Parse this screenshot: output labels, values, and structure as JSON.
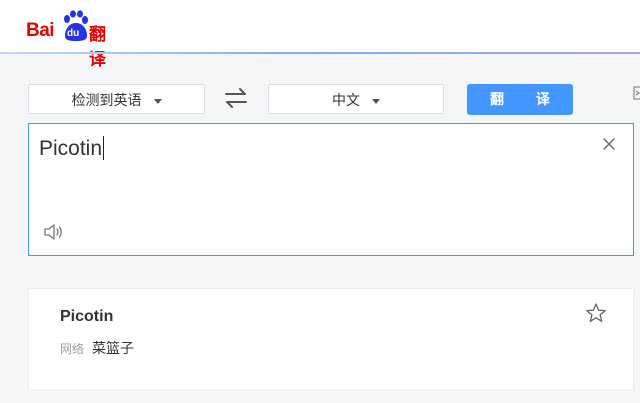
{
  "header": {
    "logo": {
      "text_bai": "Bai",
      "text_du": "du",
      "text_product": "翻译",
      "brand_color": "#e10602"
    }
  },
  "toolbar": {
    "source_language": "检测到英语",
    "target_language": "中文",
    "translate_label": "翻 译",
    "accent_color": "#4395ff",
    "icons": [
      "chevron-down-icon",
      "swap-icon",
      "side-panel-icon"
    ]
  },
  "input": {
    "text": "Picotin",
    "icons": [
      "clear-icon",
      "speaker-icon"
    ]
  },
  "result": {
    "word": "Picotin",
    "entries": [
      {
        "tag": "网络",
        "meaning": "菜篮子"
      }
    ],
    "icons": [
      "star-icon"
    ]
  }
}
